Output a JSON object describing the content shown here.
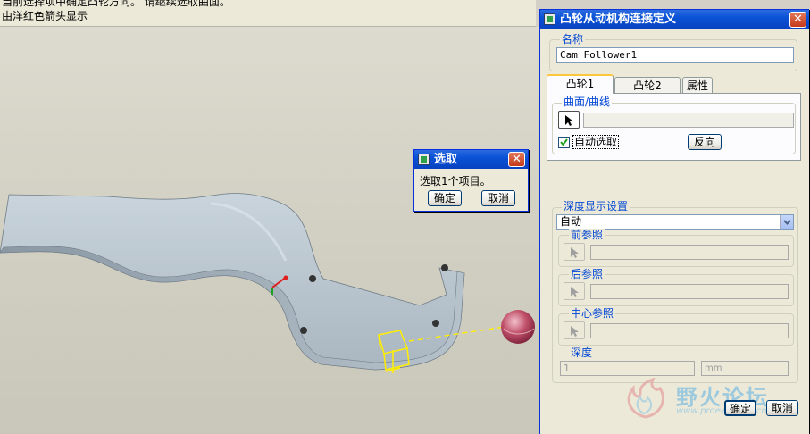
{
  "prompt": {
    "line1": "当前选择项中确定凸轮方向。 请继续选取曲面。",
    "line2": "由洋红色箭头显示"
  },
  "select_dialog": {
    "title": "选取",
    "message": "选取1个项目。",
    "ok_label": "确定",
    "cancel_label": "取消"
  },
  "main_dialog": {
    "title": "凸轮从动机构连接定义",
    "name_label": "名称",
    "name_value": "Cam Follower1",
    "tabs": [
      "凸轮1",
      "凸轮2",
      "属性"
    ],
    "surface_group_label": "曲面/曲线",
    "surface_value": "",
    "auto_select_label": "自动选取",
    "auto_select_checked": true,
    "reverse_label": "反向",
    "depth_group_label": "深度显示设置",
    "depth_mode": "自动",
    "front_ref_label": "前参照",
    "back_ref_label": "后参照",
    "center_ref_label": "中心参照",
    "depth_label": "深度",
    "depth_value": "1",
    "depth_unit": "mm",
    "ok_label": "确定",
    "cancel_label": "取消"
  },
  "watermark": {
    "name": "野火论坛",
    "url": "www.proewildfire.cn"
  },
  "colors": {
    "title_blue": "#0a52d6",
    "close_red": "#c4391a",
    "group_blue_label": "#0046d5",
    "ball_magenta": "#c0506a",
    "highlight_yellow": "#ffee00"
  }
}
